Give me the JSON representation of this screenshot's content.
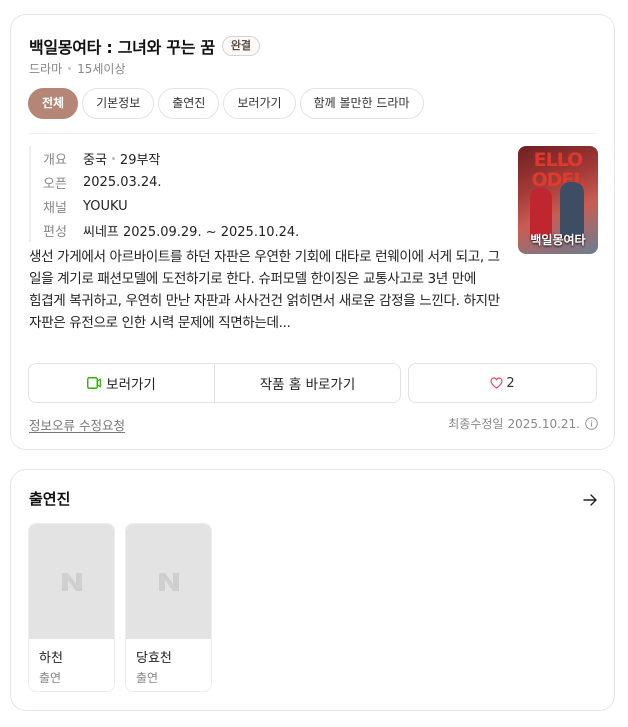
{
  "header": {
    "title": "백일몽여타 : 그녀와 꾸는 꿈",
    "status_badge": "완결",
    "genre": "드라마",
    "rating": "15세이상"
  },
  "tabs": [
    {
      "label": "전체",
      "active": true
    },
    {
      "label": "기본정보",
      "active": false
    },
    {
      "label": "출연진",
      "active": false
    },
    {
      "label": "보러가기",
      "active": false
    },
    {
      "label": "함께 볼만한 드라마",
      "active": false
    }
  ],
  "info": {
    "summary": {
      "label": "개요",
      "country": "중국",
      "episodes": "29부작"
    },
    "open": {
      "label": "오픈",
      "value": "2025.03.24."
    },
    "channel": {
      "label": "채널",
      "value": "YOUKU"
    },
    "schedule": {
      "label": "편성",
      "value": "씨네프 2025.09.29. ~ 2025.10.24."
    }
  },
  "poster": {
    "top_text": "ELLO ODEL",
    "title": "백일몽여타"
  },
  "description": "생선 가게에서 아르바이트를 하던 자판은 우연한 기회에 대타로 런웨이에 서게 되고, 그 일을 계기로 패션모델에 도전하기로 한다. 슈퍼모델 한이징은 교통사고로 3년 만에 힘겹게 복귀하고, 우연히 만난 자판과 사사건건 얽히면서 새로운 감정을 느낀다. 하지만 자판은 유전으로 인한 시력 문제에 직면하는데...",
  "actions": {
    "watch_label": "보러가기",
    "home_label": "작품 홈 바로가기",
    "like_count": "2"
  },
  "footer": {
    "report_label": "정보오류 수정요청",
    "updated_label": "최종수정일",
    "updated_date": "2025.10.21."
  },
  "cast_section": {
    "title": "출연진",
    "members": [
      {
        "name": "하천",
        "role": "출연"
      },
      {
        "name": "당효천",
        "role": "출연"
      }
    ]
  },
  "colors": {
    "accent": "#b58676",
    "watch_icon": "#2db400",
    "heart": "#e0505b"
  },
  "icons": [
    "play-icon",
    "heart-icon",
    "info-icon",
    "arrow-right-icon",
    "naver-logo-icon"
  ]
}
